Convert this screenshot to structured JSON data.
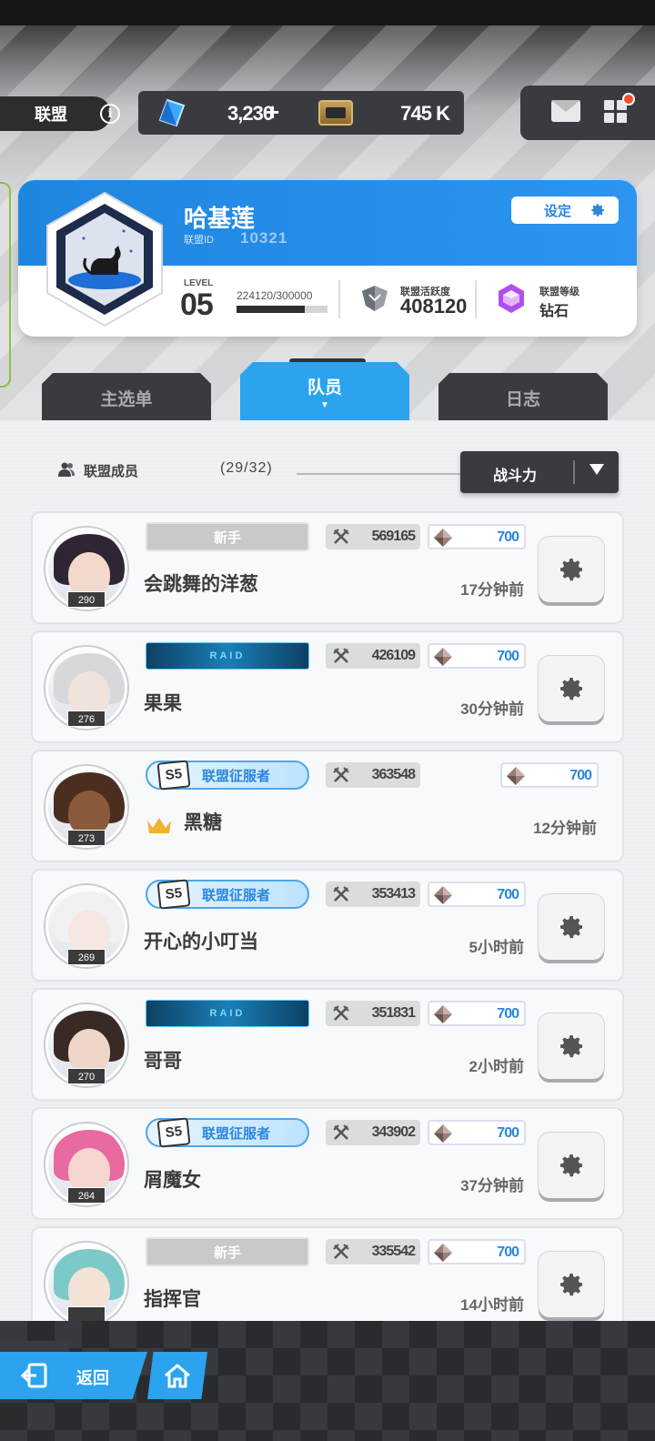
{
  "top_bar": {
    "alliance_label": "联盟",
    "gems": "3,230",
    "gems_plus": "+",
    "credits": "745 K"
  },
  "profile": {
    "name": "哈基莲",
    "id_label": "联盟ID",
    "id": "10321",
    "settings_label": "设定",
    "level_label": "LEVEL",
    "level": "05",
    "exp": "224120/300000",
    "exp_fraction": 0.747,
    "activity_label": "联盟活跃度",
    "activity_value": "408120",
    "grade_label": "联盟等级",
    "grade_value": "钻石"
  },
  "tabs": [
    "主选单",
    "队员",
    "日志"
  ],
  "active_tab_arrow": "▼",
  "members_header": {
    "label": "联盟成员",
    "count": "(29/32)",
    "sort_label": "战斗力"
  },
  "members": [
    {
      "badge": "新手",
      "power": "569165",
      "gems": "700",
      "name": "会跳舞的洋葱",
      "time": "17分钟前",
      "level": "290"
    },
    {
      "badge": "RAID",
      "power": "426109",
      "gems": "700",
      "name": "果果",
      "time": "30分钟前",
      "level": "276"
    },
    {
      "badge": "联盟征服者",
      "badge_tag": "S5",
      "power": "363548",
      "gems": "700",
      "name": "黑糖",
      "time": "12分钟前",
      "level": "273"
    },
    {
      "badge": "联盟征服者",
      "badge_tag": "S5",
      "power": "353413",
      "gems": "700",
      "name": "开心的小叮当",
      "time": "5小时前",
      "level": "269"
    },
    {
      "badge": "RAID",
      "power": "351831",
      "gems": "700",
      "name": "哥哥",
      "time": "2小时前",
      "level": "270"
    },
    {
      "badge": "联盟征服者",
      "badge_tag": "S5",
      "power": "343902",
      "gems": "700",
      "name": "屑魔女",
      "time": "37分钟前",
      "level": "264"
    },
    {
      "badge": "新手",
      "power": "335542",
      "gems": "700",
      "name": "指挥官",
      "time": "14小时前",
      "level": ""
    }
  ],
  "bottom": {
    "back_label": "返回"
  },
  "colors": {
    "accent_blue": "#2ba3ee",
    "dark_panel": "#3a3b40",
    "gem_blue": "#2b86de"
  }
}
